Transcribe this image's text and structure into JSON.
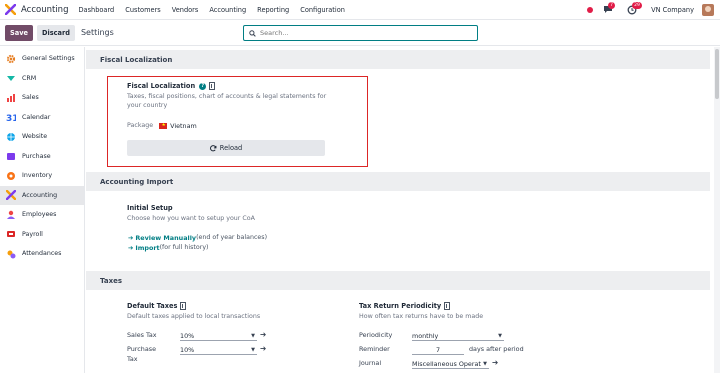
{
  "app": {
    "name": "Accounting",
    "menu": [
      "Dashboard",
      "Customers",
      "Vendors",
      "Accounting",
      "Reporting",
      "Configuration"
    ],
    "messages_count": "7",
    "activities_count": "29",
    "company": "VN Company"
  },
  "control": {
    "save": "Save",
    "discard": "Discard",
    "breadcrumb": "Settings",
    "search_placeholder": "Search..."
  },
  "sidebar": {
    "items": [
      {
        "label": "General Settings",
        "icon": "gear-icon",
        "color": "#e67e22"
      },
      {
        "label": "CRM",
        "icon": "crm-icon",
        "color": "#14b8a6"
      },
      {
        "label": "Sales",
        "icon": "sales-icon",
        "color": "#ef4444"
      },
      {
        "label": "Calendar",
        "icon": "calendar-icon",
        "color": "#2563eb"
      },
      {
        "label": "Website",
        "icon": "website-icon",
        "color": "#0ea5e9"
      },
      {
        "label": "Purchase",
        "icon": "purchase-icon",
        "color": "#7c3aed"
      },
      {
        "label": "Inventory",
        "icon": "inventory-icon",
        "color": "#f97316"
      },
      {
        "label": "Accounting",
        "icon": "accounting-icon",
        "color": "#f59e0b"
      },
      {
        "label": "Employees",
        "icon": "employees-icon",
        "color": "#8b5cf6"
      },
      {
        "label": "Payroll",
        "icon": "payroll-icon",
        "color": "#dc2626"
      },
      {
        "label": "Attendances",
        "icon": "attendances-icon",
        "color": "#f59e0b"
      }
    ],
    "active_index": 7
  },
  "sections": {
    "fiscal": {
      "header": "Fiscal Localization",
      "title": "Fiscal Localization",
      "description": "Taxes, fiscal positions, chart of accounts & legal statements for your country",
      "package_label": "Package",
      "package_value": "Vietnam",
      "reload": "Reload"
    },
    "import": {
      "header": "Accounting Import",
      "title": "Initial Setup",
      "description": "Choose how you want to setup your CoA",
      "review_link": "Review Manually",
      "review_note": "(end of year balances)",
      "import_link": "Import",
      "import_note": "(for full history)"
    },
    "taxes": {
      "header": "Taxes",
      "default_title": "Default Taxes",
      "default_desc": "Default taxes applied to local transactions",
      "sales_tax_label": "Sales Tax",
      "sales_tax_value": "10%",
      "purchase_tax_label": "Purchase",
      "purchase_tax_label2": "Tax",
      "purchase_tax_value": "10%",
      "periodicity_title": "Tax Return Periodicity",
      "periodicity_desc": "How often tax returns have to be made",
      "periodicity_label": "Periodicity",
      "periodicity_value": "monthly",
      "reminder_label": "Reminder",
      "reminder_value": "7",
      "reminder_suffix": "days after period",
      "journal_label": "Journal",
      "journal_value": "Miscellaneous Operat"
    }
  },
  "colors": {
    "brand": "#714b67",
    "accent": "#017e84",
    "highlight": "#dc2626"
  }
}
